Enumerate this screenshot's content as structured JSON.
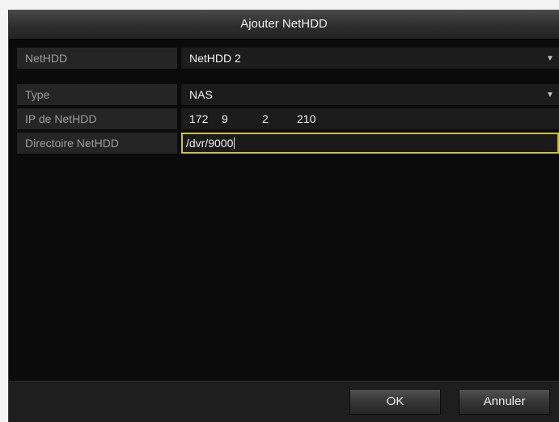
{
  "dialog": {
    "title": "Ajouter NetHDD",
    "fields": {
      "nethdd": {
        "label": "NetHDD",
        "value": "NetHDD 2"
      },
      "type": {
        "label": "Type",
        "value": "NAS"
      },
      "ip": {
        "label": "IP de NetHDD",
        "octets": [
          "172",
          "9",
          "2",
          "210"
        ]
      },
      "directory": {
        "label": "Directoire NetHDD",
        "value": "/dvr/9000"
      }
    },
    "buttons": {
      "ok": "OK",
      "cancel": "Annuler"
    },
    "icons": {
      "dropdown": "chevron-down-icon"
    },
    "colors": {
      "focus_border": "#cfc23a"
    }
  }
}
